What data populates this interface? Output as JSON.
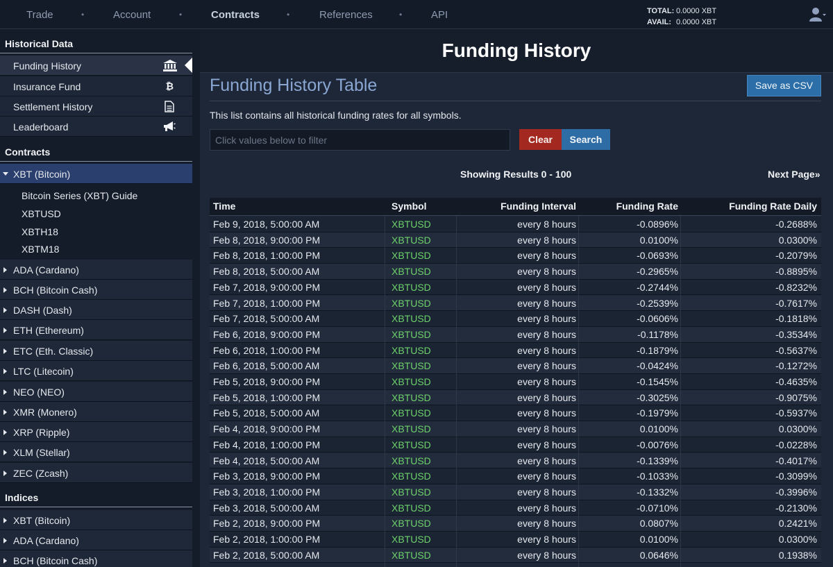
{
  "nav": {
    "items": [
      {
        "label": "Trade",
        "active": false
      },
      {
        "label": "Account",
        "active": false
      },
      {
        "label": "Contracts",
        "active": true
      },
      {
        "label": "References",
        "active": false
      },
      {
        "label": "API",
        "active": false
      }
    ],
    "dot": "•",
    "balance": {
      "total_label": "TOTAL:",
      "total_value": "0.0000 XBT",
      "avail_label": "AVAIL:",
      "avail_value": "0.0000 XBT"
    },
    "user_icon": "user-icon"
  },
  "sidebar": {
    "historical_header": "Historical Data",
    "historical_items": [
      {
        "label": "Funding History",
        "icon": "bank-icon",
        "active": true
      },
      {
        "label": "Insurance Fund",
        "icon": "bitcoin-icon",
        "active": false
      },
      {
        "label": "Settlement History",
        "icon": "document-icon",
        "active": false
      },
      {
        "label": "Leaderboard",
        "icon": "megaphone-icon",
        "active": false
      }
    ],
    "contracts_header": "Contracts",
    "contracts_open": {
      "label": "XBT (Bitcoin)",
      "children": [
        "Bitcoin Series (XBT) Guide",
        "XBTUSD",
        "XBTH18",
        "XBTM18"
      ]
    },
    "contracts_items": [
      "ADA (Cardano)",
      "BCH (Bitcoin Cash)",
      "DASH (Dash)",
      "ETH (Ethereum)",
      "ETC (Eth. Classic)",
      "LTC (Litecoin)",
      "NEO (NEO)",
      "XMR (Monero)",
      "XRP (Ripple)",
      "XLM (Stellar)",
      "ZEC (Zcash)"
    ],
    "indices_header": "Indices",
    "indices_items": [
      "XBT (Bitcoin)",
      "ADA (Cardano)",
      "BCH (Bitcoin Cash)"
    ]
  },
  "main": {
    "page_title": "Funding History",
    "table_title": "Funding History Table",
    "save_csv_label": "Save as CSV",
    "description": "This list contains all historical funding rates for all symbols.",
    "filter_placeholder": "Click values below to filter",
    "clear_label": "Clear",
    "search_label": "Search",
    "showing": "Showing Results 0 - 100",
    "next_page": "Next Page»"
  },
  "table": {
    "columns": [
      "Time",
      "Symbol",
      "Funding Interval",
      "Funding Rate",
      "Funding Rate Daily"
    ],
    "rows": [
      [
        "Feb 9, 2018, 5:00:00 AM",
        "XBTUSD",
        "every 8 hours",
        "-0.0896%",
        "-0.2688%"
      ],
      [
        "Feb 8, 2018, 9:00:00 PM",
        "XBTUSD",
        "every 8 hours",
        "0.0100%",
        "0.0300%"
      ],
      [
        "Feb 8, 2018, 1:00:00 PM",
        "XBTUSD",
        "every 8 hours",
        "-0.0693%",
        "-0.2079%"
      ],
      [
        "Feb 8, 2018, 5:00:00 AM",
        "XBTUSD",
        "every 8 hours",
        "-0.2965%",
        "-0.8895%"
      ],
      [
        "Feb 7, 2018, 9:00:00 PM",
        "XBTUSD",
        "every 8 hours",
        "-0.2744%",
        "-0.8232%"
      ],
      [
        "Feb 7, 2018, 1:00:00 PM",
        "XBTUSD",
        "every 8 hours",
        "-0.2539%",
        "-0.7617%"
      ],
      [
        "Feb 7, 2018, 5:00:00 AM",
        "XBTUSD",
        "every 8 hours",
        "-0.0606%",
        "-0.1818%"
      ],
      [
        "Feb 6, 2018, 9:00:00 PM",
        "XBTUSD",
        "every 8 hours",
        "-0.1178%",
        "-0.3534%"
      ],
      [
        "Feb 6, 2018, 1:00:00 PM",
        "XBTUSD",
        "every 8 hours",
        "-0.1879%",
        "-0.5637%"
      ],
      [
        "Feb 6, 2018, 5:00:00 AM",
        "XBTUSD",
        "every 8 hours",
        "-0.0424%",
        "-0.1272%"
      ],
      [
        "Feb 5, 2018, 9:00:00 PM",
        "XBTUSD",
        "every 8 hours",
        "-0.1545%",
        "-0.4635%"
      ],
      [
        "Feb 5, 2018, 1:00:00 PM",
        "XBTUSD",
        "every 8 hours",
        "-0.3025%",
        "-0.9075%"
      ],
      [
        "Feb 5, 2018, 5:00:00 AM",
        "XBTUSD",
        "every 8 hours",
        "-0.1979%",
        "-0.5937%"
      ],
      [
        "Feb 4, 2018, 9:00:00 PM",
        "XBTUSD",
        "every 8 hours",
        "0.0100%",
        "0.0300%"
      ],
      [
        "Feb 4, 2018, 1:00:00 PM",
        "XBTUSD",
        "every 8 hours",
        "-0.0076%",
        "-0.0228%"
      ],
      [
        "Feb 4, 2018, 5:00:00 AM",
        "XBTUSD",
        "every 8 hours",
        "-0.1339%",
        "-0.4017%"
      ],
      [
        "Feb 3, 2018, 9:00:00 PM",
        "XBTUSD",
        "every 8 hours",
        "-0.1033%",
        "-0.3099%"
      ],
      [
        "Feb 3, 2018, 1:00:00 PM",
        "XBTUSD",
        "every 8 hours",
        "-0.1332%",
        "-0.3996%"
      ],
      [
        "Feb 3, 2018, 5:00:00 AM",
        "XBTUSD",
        "every 8 hours",
        "-0.0710%",
        "-0.2130%"
      ],
      [
        "Feb 2, 2018, 9:00:00 PM",
        "XBTUSD",
        "every 8 hours",
        "0.0807%",
        "0.2421%"
      ],
      [
        "Feb 2, 2018, 1:00:00 PM",
        "XBTUSD",
        "every 8 hours",
        "0.0100%",
        "0.0300%"
      ],
      [
        "Feb 2, 2018, 5:00:00 AM",
        "XBTUSD",
        "every 8 hours",
        "0.0646%",
        "0.1938%"
      ]
    ]
  },
  "colors": {
    "symbol": "#6dd26a",
    "accent": "#2e6ca6",
    "danger": "#a3281f",
    "table_title": "#8aa7d4"
  }
}
